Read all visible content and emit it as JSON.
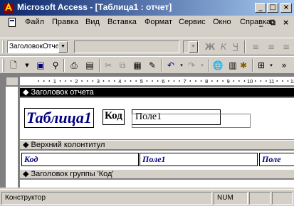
{
  "window": {
    "title": "Microsoft Access - [Таблица1 : отчет]"
  },
  "menubar": {
    "items": [
      "Файл",
      "Правка",
      "Вид",
      "Вставка",
      "Формат",
      "Сервис",
      "Окно",
      "Справка"
    ]
  },
  "formatting": {
    "object_combo": "ЗаголовокОтче",
    "font_combo": "",
    "size_combo": "",
    "bold_icon": "bold-icon",
    "italic_icon": "italic-icon",
    "underline_icon": "underline-icon"
  },
  "sections": {
    "report_header": "Заголовок отчета",
    "page_header": "Верхний колонтитул",
    "group_header": "Заголовок группы 'Код'"
  },
  "controls": {
    "title_label": "Таблица1",
    "kod_label": "Код",
    "pole_textbox": "Поле1",
    "col_kod": "Код",
    "col_pole": "Поле1",
    "col_pole2": "Поле"
  },
  "ruler": {
    "marks": [
      "1",
      "2",
      "3",
      "4",
      "5",
      "6",
      "7",
      "8",
      "9",
      "10",
      "11",
      "12"
    ]
  },
  "statusbar": {
    "mode": "Конструктор",
    "num": "NUM"
  },
  "colors": {
    "title_bar": "#0a246a",
    "label_text": "#000080",
    "section_active": "#000000"
  }
}
